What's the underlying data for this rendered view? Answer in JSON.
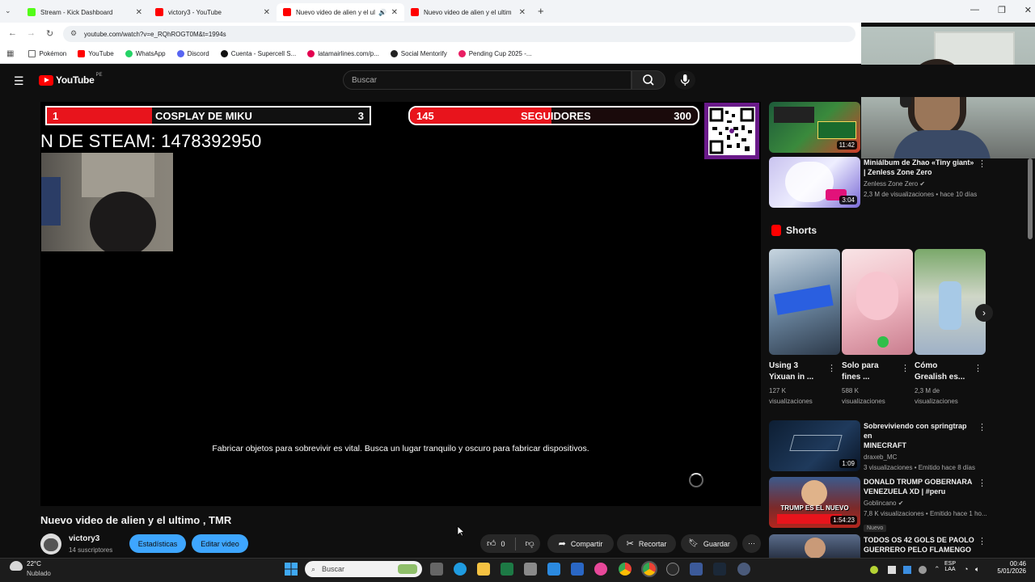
{
  "browser": {
    "tabs": [
      {
        "label": "Stream - Kick Dashboard",
        "color": "#53fc18"
      },
      {
        "label": "victory3 - YouTube",
        "color": "#ff0000"
      },
      {
        "label": "Nuevo video de alien y el ul",
        "color": "#ff0000"
      },
      {
        "label": "Nuevo video de alien y el ultim",
        "color": "#ff0000"
      }
    ],
    "url": "youtube.com/watch?v=e_RQhROGT0M&t=1994s",
    "bookmarks": [
      {
        "label": "Pokémon",
        "color": "#888888"
      },
      {
        "label": "YouTube",
        "color": "#ff0000"
      },
      {
        "label": "WhatsApp",
        "color": "#25d366"
      },
      {
        "label": "Discord",
        "color": "#5865f2"
      },
      {
        "label": "Cuenta - Supercell S...",
        "color": "#111111"
      },
      {
        "label": "latamairlines.com/p...",
        "color": "#e3004f"
      },
      {
        "label": "Social Mentorify",
        "color": "#222222"
      },
      {
        "label": "Pending Cup 2025 -...",
        "color": "#e91e63"
      }
    ]
  },
  "youtube": {
    "logo": "YouTube",
    "region": "PE",
    "search_placeholder": "Buscar"
  },
  "player": {
    "bar1_left": "1",
    "bar1_title": "COSPLAY DE MIKU",
    "bar1_right": "3",
    "bar2_left": "145",
    "bar2_title": "SEGUIDORES",
    "bar2_right": "300",
    "steam_text": "N DE STEAM: 1478392950",
    "subtitle": "Fabricar objetos para sobrevivir es vital. Busca un lugar tranquilo y oscuro para fabricar dispositivos."
  },
  "video": {
    "title": "Nuevo video de alien y el ultimo , TMR",
    "channel": "victory3",
    "subscribers": "14 suscriptores",
    "stats_button": "Estadísticas",
    "edit_button": "Editar video",
    "likes": "0",
    "share": "Compartir",
    "clip": "Recortar",
    "save": "Guardar"
  },
  "sidebar": {
    "top_duration": "11:42",
    "item1": {
      "title_l1": "Miniálbum de Zhao «Tiny giant»",
      "title_l2": "| Zenless Zone Zero",
      "channel": "Zenless Zone Zero",
      "meta": "2,3 M de visualizaciones • hace 10 días",
      "duration": "3:04"
    },
    "shorts_label": "Shorts",
    "shorts": [
      {
        "t1": "Using 3",
        "t2": "Yixuan in ...",
        "v1": "127 K",
        "v2": "visualizaciones"
      },
      {
        "t1": "Solo para",
        "t2": "fines ...",
        "v1": "588 K",
        "v2": "visualizaciones"
      },
      {
        "t1": "Cómo",
        "t2": "Grealish es...",
        "v1": "2,3 M de",
        "v2": "visualizaciones"
      }
    ],
    "item2": {
      "title_l1": "Sobreviviendo con springtrap en",
      "title_l2": "MINECRAFT",
      "channel": "draxeb_MC",
      "meta": "3 visualizaciones • Emitido hace 8 días",
      "duration": "1:09"
    },
    "item3": {
      "title_l1": "DONALD TRUMP GOBERNARA",
      "title_l2": "VENEZUELA XD | #peru",
      "channel": "Goblincano",
      "meta": "7,8 K visualizaciones • Emitido hace 1 ho...",
      "badge": "Nuevo",
      "duration": "1:54:23",
      "thumb_text": "TRUMP ES EL NUEVO"
    },
    "item4": {
      "title_l1": "TODOS OS 42 GOLS DE PAOLO",
      "title_l2": "GUERRERO PELO FLAMENGO ..."
    }
  },
  "taskbar": {
    "weather_temp": "22°C",
    "weather_desc": "Nublado",
    "search": "Buscar",
    "lang1": "ESP",
    "lang2": "LAA",
    "time": "00:46",
    "date": "5/01/2026"
  }
}
